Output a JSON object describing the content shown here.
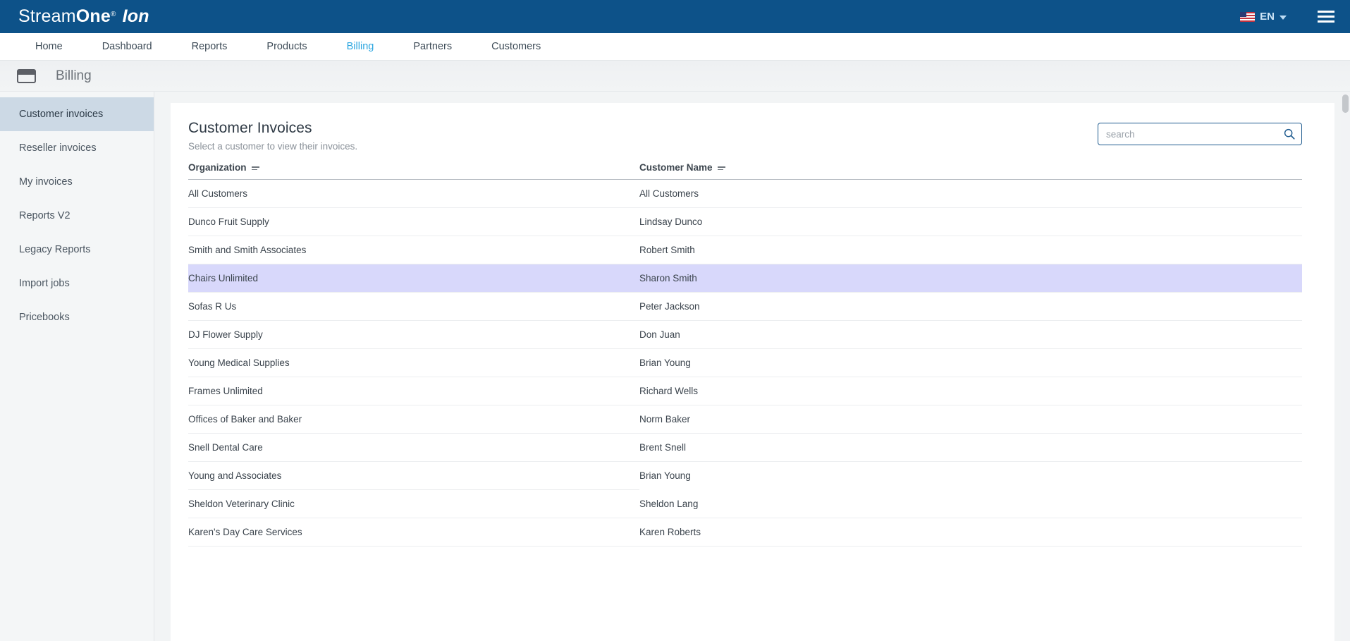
{
  "topbar": {
    "brand": {
      "part1": "Stream",
      "part2": "One",
      "registered": "®",
      "part3": "Ion"
    },
    "language": {
      "code": "EN",
      "flag_icon": "us-flag-icon"
    },
    "menu_icon": "hamburger-menu-icon"
  },
  "mainnav": {
    "items": [
      {
        "label": "Home",
        "active": false
      },
      {
        "label": "Dashboard",
        "active": false
      },
      {
        "label": "Reports",
        "active": false
      },
      {
        "label": "Products",
        "active": false
      },
      {
        "label": "Billing",
        "active": true
      },
      {
        "label": "Partners",
        "active": false
      },
      {
        "label": "Customers",
        "active": false
      }
    ],
    "active_color": "#2ba6e0"
  },
  "pageheader": {
    "icon": "credit-card-icon",
    "title": "Billing"
  },
  "sidebar": {
    "items": [
      {
        "label": "Customer invoices",
        "active": true
      },
      {
        "label": "Reseller invoices",
        "active": false
      },
      {
        "label": "My invoices",
        "active": false
      },
      {
        "label": "Reports V2",
        "active": false
      },
      {
        "label": "Legacy Reports",
        "active": false
      },
      {
        "label": "Import jobs",
        "active": false
      },
      {
        "label": "Pricebooks",
        "active": false
      }
    ],
    "active_bg": "#ccd9e5"
  },
  "main": {
    "title": "Customer Invoices",
    "subtitle": "Select a customer to view their invoices.",
    "search": {
      "value": "",
      "placeholder": "search",
      "icon": "search-icon"
    },
    "table": {
      "columns": [
        {
          "label": "Organization",
          "sort_icon": "sort-filter-icon"
        },
        {
          "label": "Customer Name",
          "sort_icon": "sort-filter-icon"
        }
      ],
      "rows": [
        {
          "organization": "All Customers",
          "customer_name": "All Customers",
          "selected": false
        },
        {
          "organization": "Dunco Fruit Supply",
          "customer_name": "Lindsay Dunco",
          "selected": false
        },
        {
          "organization": "Smith and Smith Associates",
          "customer_name": "Robert Smith",
          "selected": false
        },
        {
          "organization": "Chairs Unlimited",
          "customer_name": "Sharon Smith",
          "selected": true
        },
        {
          "organization": "Sofas R Us",
          "customer_name": "Peter Jackson",
          "selected": false
        },
        {
          "organization": "DJ Flower Supply",
          "customer_name": "Don Juan",
          "selected": false
        },
        {
          "organization": "Young Medical Supplies",
          "customer_name": "Brian Young",
          "selected": false
        },
        {
          "organization": "Frames Unlimited",
          "customer_name": "Richard Wells",
          "selected": false
        },
        {
          "organization": "Offices of Baker and Baker",
          "customer_name": "Norm Baker",
          "selected": false
        },
        {
          "organization": "Snell Dental Care",
          "customer_name": "Brent Snell",
          "selected": false
        },
        {
          "organization": "Young and Associates",
          "customer_name": "Brian Young",
          "selected": false,
          "short_divider": true
        },
        {
          "organization": "Sheldon Veterinary Clinic",
          "customer_name": "Sheldon Lang",
          "selected": false
        },
        {
          "organization": "Karen's Day Care Services",
          "customer_name": "Karen Roberts",
          "selected": false
        }
      ],
      "selected_row_color": "#d8d8fb"
    }
  },
  "colors": {
    "brand_blue": "#0d5289",
    "accent_cyan": "#2ba6e0",
    "sidebar_bg": "#f4f6f7",
    "content_bg": "#f2f4f5"
  }
}
